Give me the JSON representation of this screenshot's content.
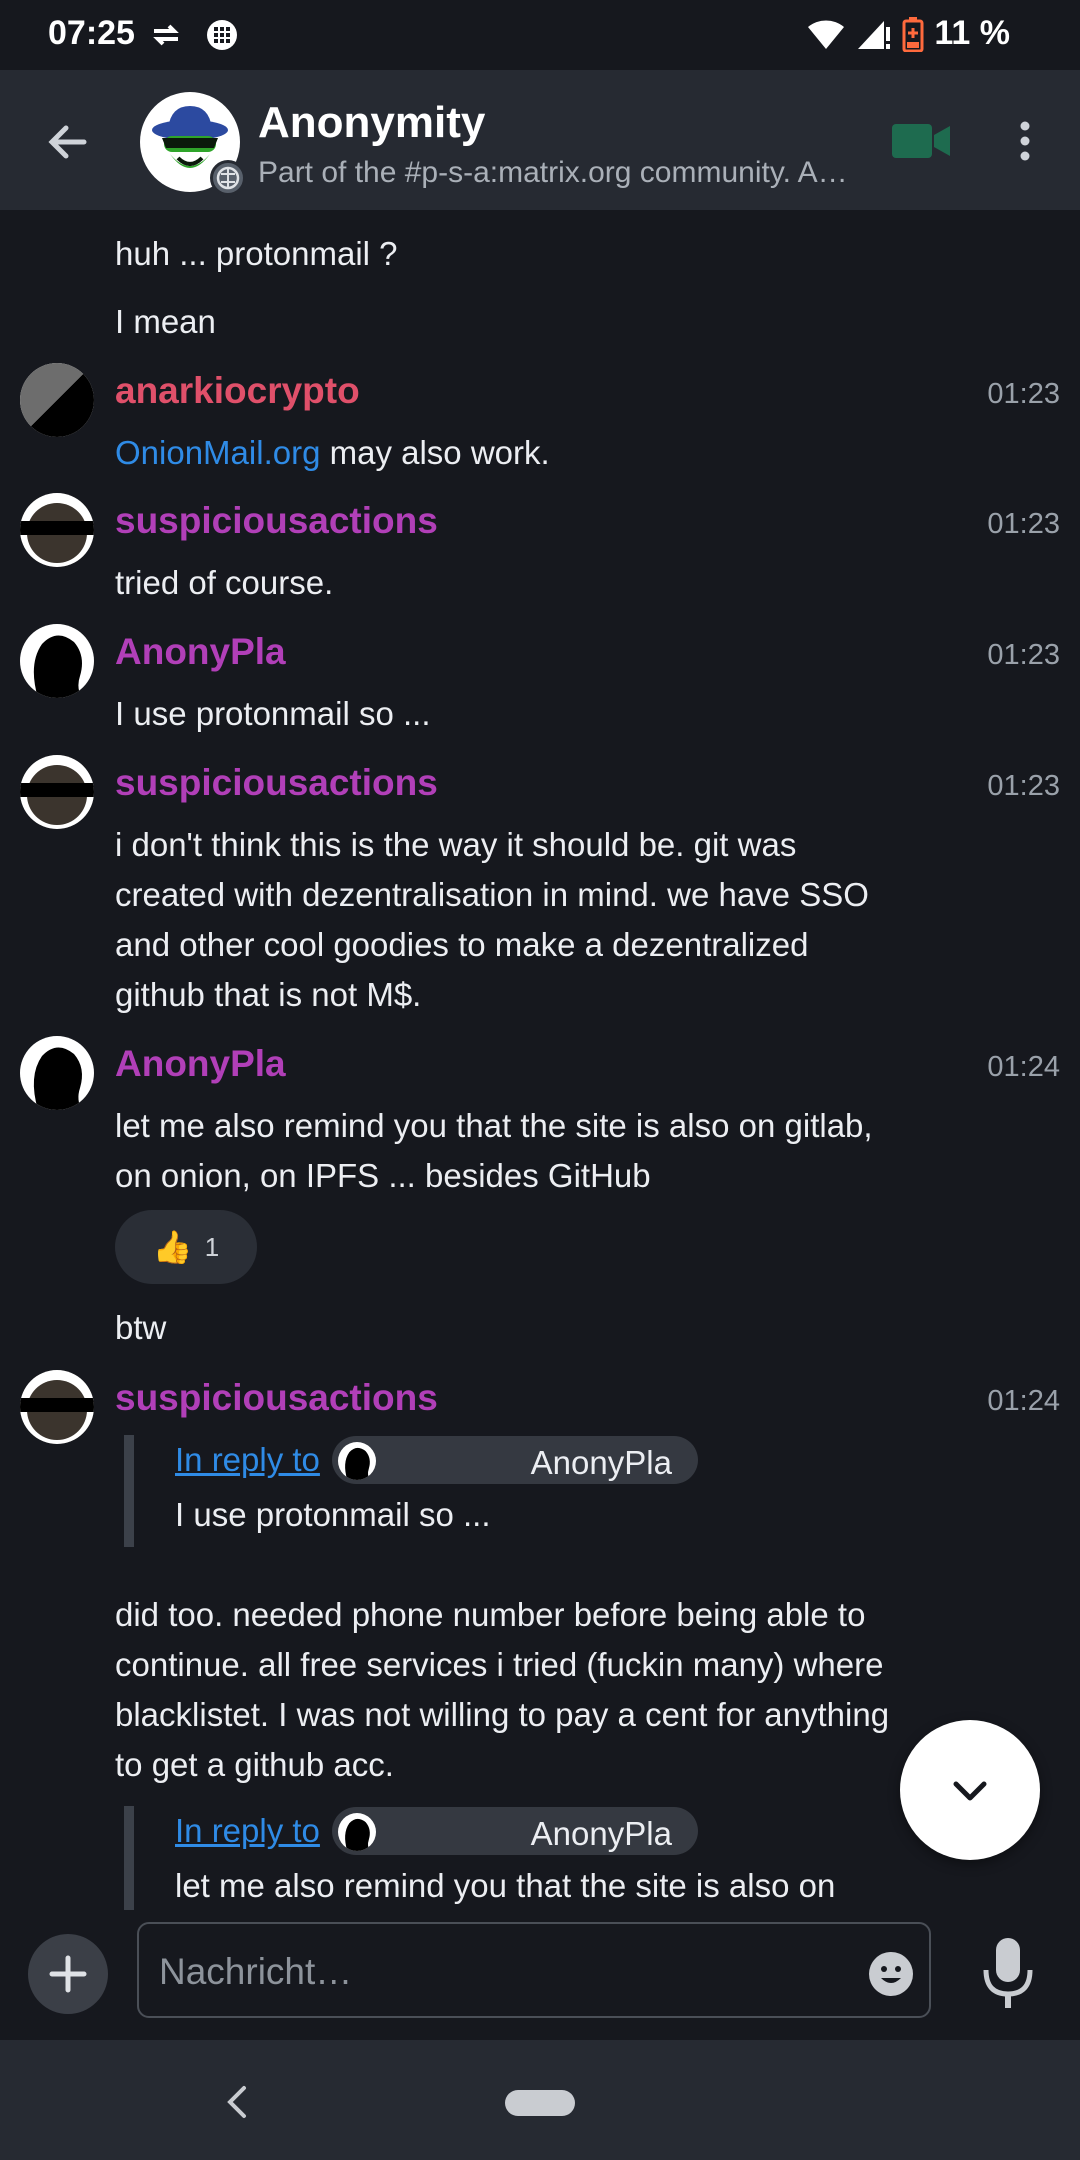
{
  "status_bar": {
    "time": "07:25",
    "battery": "11 %"
  },
  "header": {
    "title": "Anonymity",
    "topic": "Part of the #p-s-a:matrix.org community. A…"
  },
  "colors": {
    "accent": "#2f8be6",
    "sender_purple": "#b13fb8",
    "sender_red": "#e0506a",
    "video": "#1e6b4f"
  },
  "messages": {
    "m1": "huh ... protonmail ?",
    "m2": "I mean",
    "m3": {
      "sender": "anarkiocrypto",
      "time": "01:23",
      "link": "OnionMail.org",
      "text": " may also work."
    },
    "m4": {
      "sender": "suspiciousactions",
      "time": "01:23",
      "text": "tried of course."
    },
    "m5": {
      "sender": "AnonyPla",
      "time": "01:23",
      "text": "I use protonmail so ..."
    },
    "m6": {
      "sender": "suspiciousactions",
      "time": "01:23",
      "lines": [
        "i don't think this is the way it should be. git was",
        "created with dezentralisation in mind. we have SSO",
        "and other cool goodies to make a dezentralized",
        "github that is not M$."
      ]
    },
    "m7": {
      "sender": "AnonyPla",
      "time": "01:24",
      "lines": [
        "let me also remind you that the site is also on gitlab,",
        "on onion, on IPFS ... besides GitHub"
      ],
      "reaction_emoji": "👍",
      "reaction_count": "1"
    },
    "m8": "btw",
    "m9": {
      "sender": "suspiciousactions",
      "time": "01:24",
      "reply1_label": "In reply to",
      "reply1_name": "AnonyPla",
      "reply1_text": "I use protonmail so ...",
      "lines": [
        "did too. needed phone number before being able to",
        "continue. all free services i tried (fuckin many) where",
        "blacklistet. I was not willing to pay a cent for anything",
        "to get a github acc."
      ],
      "reply2_label": "In reply to",
      "reply2_name": "AnonyPla",
      "reply2_text": "let me also remind you that the site is also on"
    }
  },
  "composer": {
    "placeholder": "Nachricht…"
  }
}
